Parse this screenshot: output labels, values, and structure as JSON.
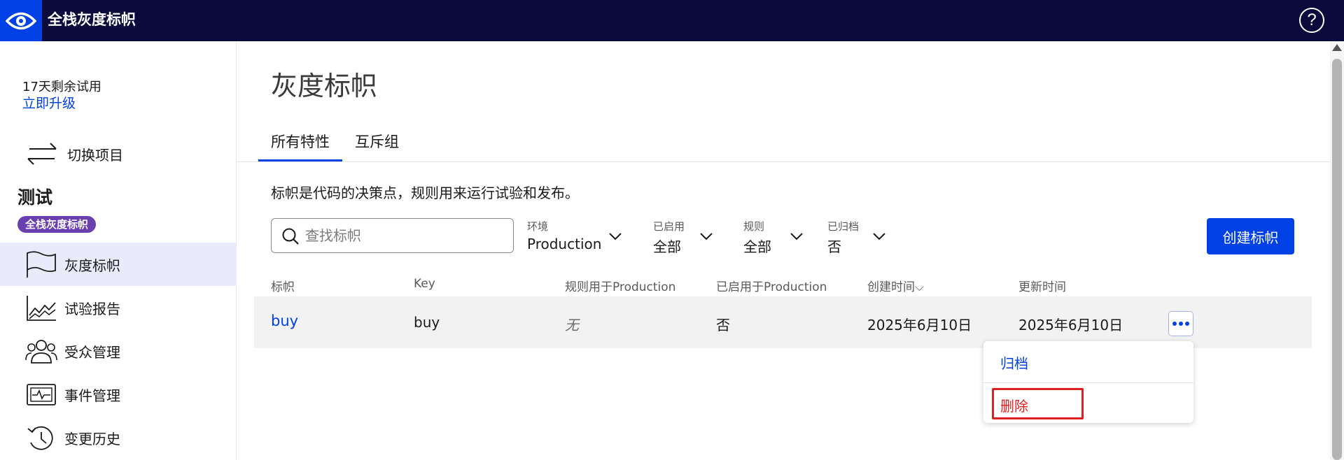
{
  "header": {
    "app_title": "全栈灰度标帜",
    "help_icon": "question-circle-icon",
    "help_glyph": "?"
  },
  "sidebar": {
    "trial_days": "17天剩余试用",
    "upgrade_label": "立即升级",
    "switch_project_label": "切换项目",
    "project_name": "测试",
    "project_badge": "全栈灰度标帜",
    "items": [
      {
        "label": "灰度标帜",
        "icon": "flag-icon",
        "active": true
      },
      {
        "label": "试验报告",
        "icon": "chart-icon",
        "active": false
      },
      {
        "label": "受众管理",
        "icon": "people-icon",
        "active": false
      },
      {
        "label": "事件管理",
        "icon": "pulse-monitor-icon",
        "active": false
      },
      {
        "label": "变更历史",
        "icon": "history-icon",
        "active": false
      }
    ]
  },
  "main": {
    "title": "灰度标帜",
    "tabs": [
      {
        "label": "所有特性",
        "active": true
      },
      {
        "label": "互斥组",
        "active": false
      }
    ],
    "description": "标帜是代码的决策点，规则用来运行试验和发布。",
    "search": {
      "placeholder": "查找标帜",
      "value": ""
    },
    "filters": [
      {
        "label": "环境",
        "value": "Production"
      },
      {
        "label": "已启用",
        "value": "全部"
      },
      {
        "label": "规则",
        "value": "全部"
      },
      {
        "label": "已归档",
        "value": "否"
      }
    ],
    "create_button": "创建标帜",
    "table": {
      "headers": [
        "标帜",
        "Key",
        "规则用于Production",
        "已启用于Production",
        "创建时间",
        "更新时间"
      ],
      "sort_indicator": "⌵",
      "rows": [
        {
          "flag": "buy",
          "key": "buy",
          "rules": "无",
          "enabled": "否",
          "created": "2025年6月10日",
          "updated": "2025年6月10日"
        }
      ]
    },
    "row_menu": {
      "archive": "归档",
      "delete": "删除"
    }
  },
  "colors": {
    "topbar": "#0a0a3c",
    "accent": "#0041e6",
    "badge": "#6a3fb0",
    "danger": "#e02020",
    "active_nav": "#e9ebfb"
  }
}
